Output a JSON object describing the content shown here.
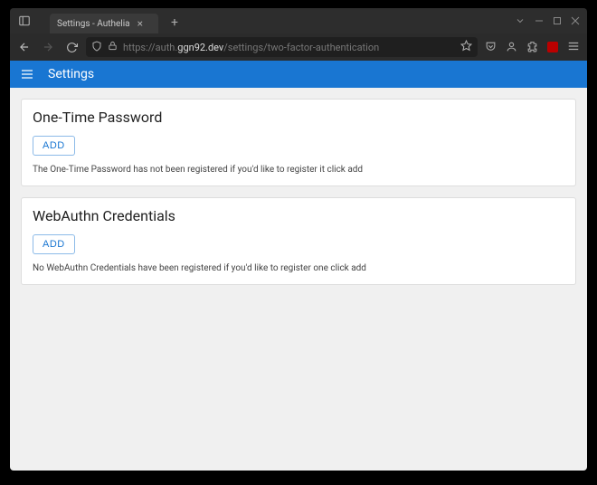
{
  "browser": {
    "tab_title": "Settings - Authelia",
    "url_scheme": "https://",
    "url_host_dim_prefix": "auth.",
    "url_host_bright": "ggn92.dev",
    "url_path": "/settings/two-factor-authentication"
  },
  "app": {
    "header_title": "Settings"
  },
  "cards": [
    {
      "title": "One-Time Password",
      "button": "ADD",
      "desc": "The One-Time Password has not been registered if you'd like to register it click add"
    },
    {
      "title": "WebAuthn Credentials",
      "button": "ADD",
      "desc": "No WebAuthn Credentials have been registered if you'd like to register one click add"
    }
  ]
}
